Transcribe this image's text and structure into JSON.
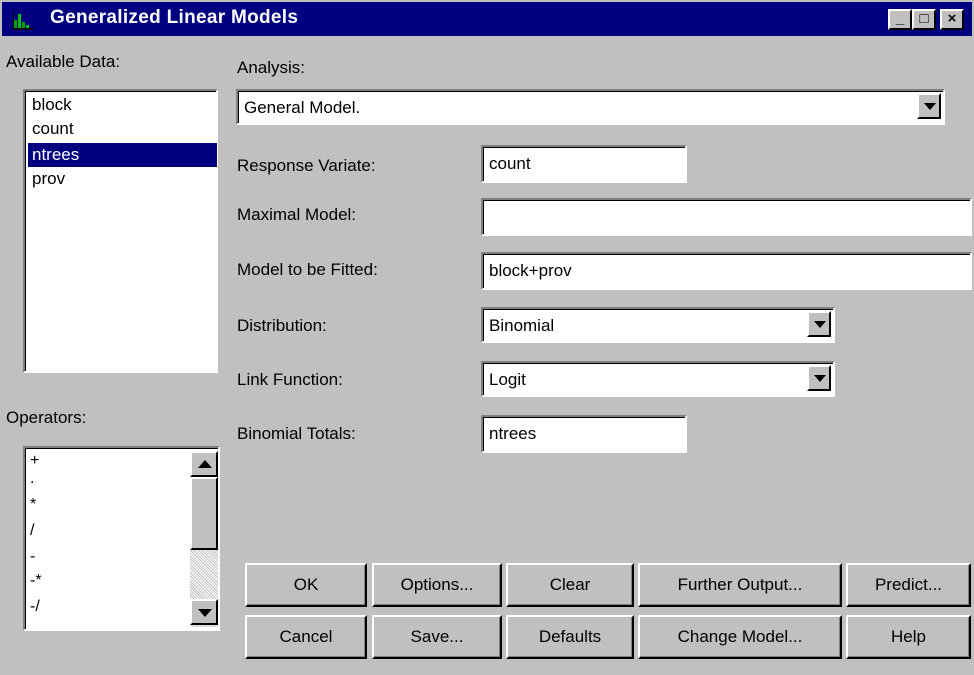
{
  "window": {
    "title": "Generalized Linear Models",
    "controls": {
      "minimize": "_",
      "maximize": "□",
      "close": "×"
    }
  },
  "available_data": {
    "label": "Available Data:",
    "items": [
      "block",
      "count",
      "ntrees",
      "prov"
    ],
    "selected": "ntrees"
  },
  "operators": {
    "label": "Operators:",
    "items": [
      "+",
      ".",
      "*",
      "/",
      "-",
      "-*",
      "-/"
    ]
  },
  "analysis": {
    "label": "Analysis:",
    "value": "General Model."
  },
  "fields": {
    "response_variate": {
      "label": "Response Variate:",
      "value": "count"
    },
    "maximal_model": {
      "label": "Maximal Model:",
      "value": ""
    },
    "model_to_be_fitted": {
      "label": "Model to be Fitted:",
      "value": "block+prov"
    },
    "distribution": {
      "label": "Distribution:",
      "value": "Binomial"
    },
    "link_function": {
      "label": "Link Function:",
      "value": "Logit"
    },
    "binomial_totals": {
      "label": "Binomial Totals:",
      "value": "ntrees"
    }
  },
  "buttons": {
    "ok": "OK",
    "options": "Options...",
    "clear": "Clear",
    "further_output": "Further Output...",
    "predict": "Predict...",
    "cancel": "Cancel",
    "save": "Save...",
    "defaults": "Defaults",
    "change_model": "Change Model...",
    "help": "Help"
  },
  "icons": {
    "app": "bar-chart-icon",
    "dropdown": "chevron-down-icon",
    "scroll_up": "arrow-up-icon",
    "scroll_down": "arrow-down-icon"
  },
  "colors": {
    "titlebar": "#000080",
    "selection": "#000080",
    "face": "#c0c0c0",
    "app_icon": "#00a000"
  }
}
